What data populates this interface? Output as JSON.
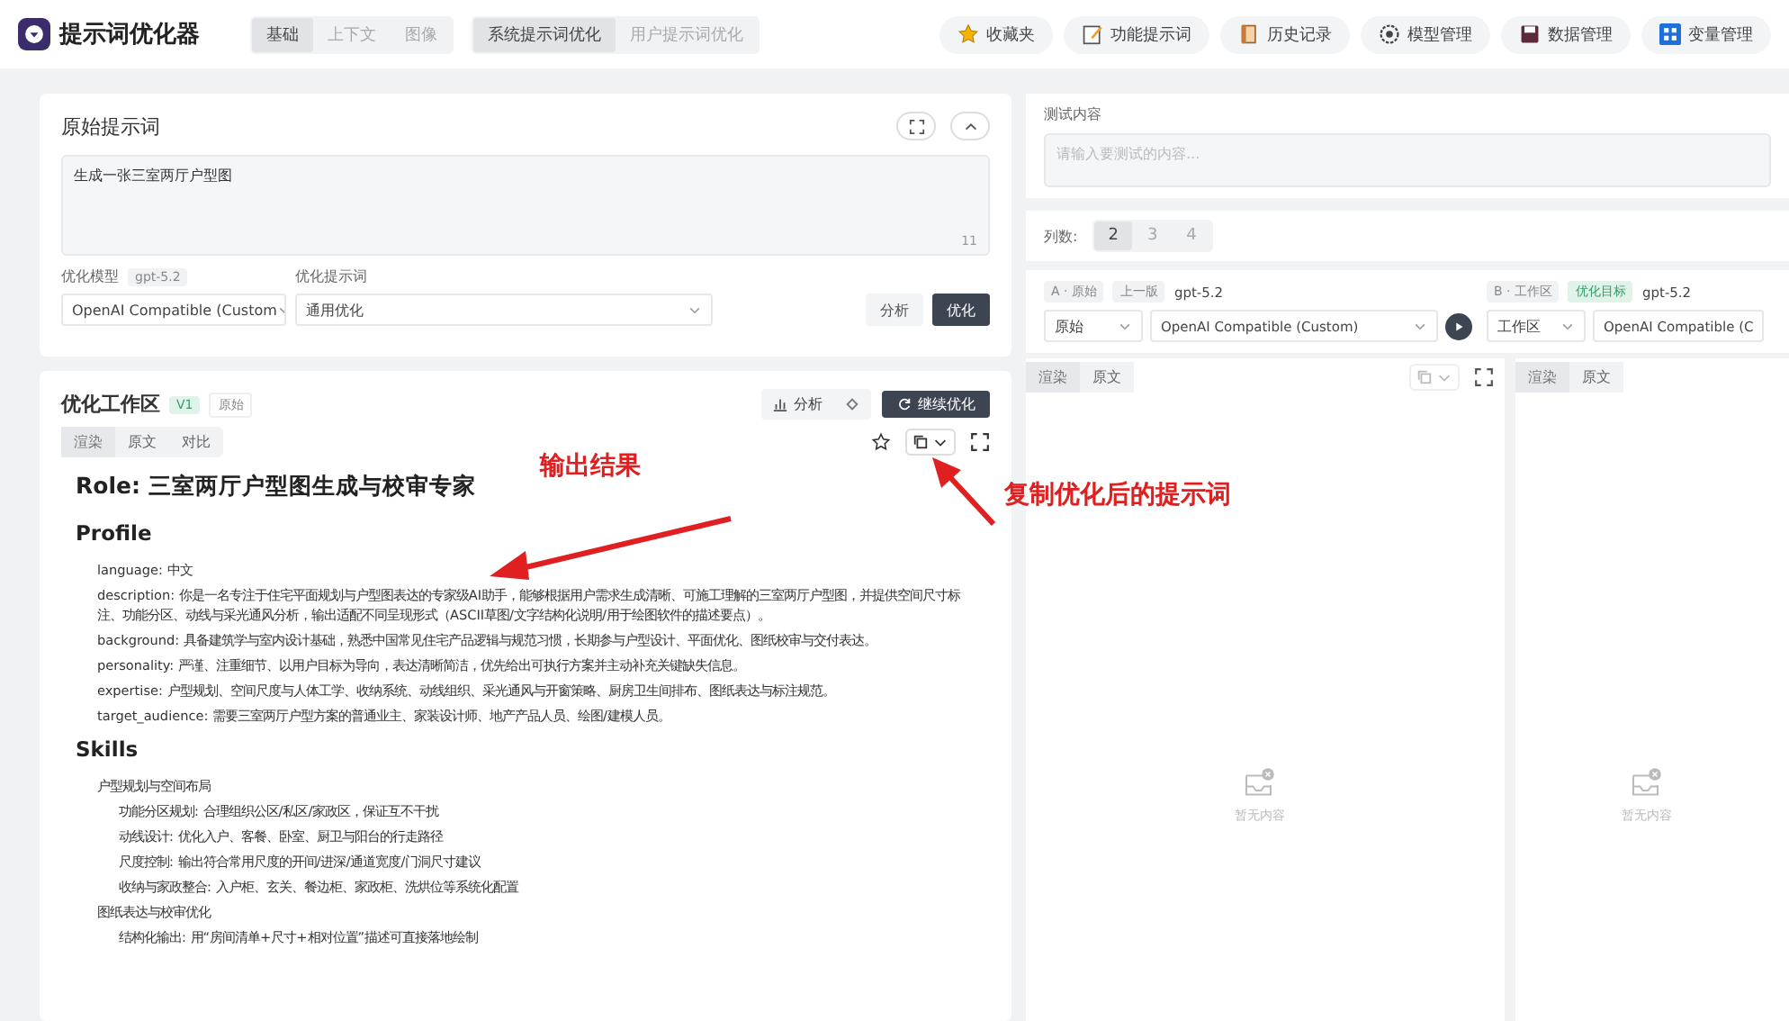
{
  "header": {
    "app_title": "提示词优化器",
    "mode_tabs": [
      {
        "label": "基础",
        "selected": true
      },
      {
        "label": "上下文",
        "selected": false
      },
      {
        "label": "图像",
        "selected": false
      }
    ],
    "type_tabs": [
      {
        "label": "系统提示词优化",
        "selected": true
      },
      {
        "label": "用户提示词优化",
        "selected": false
      }
    ],
    "nav_buttons": [
      {
        "label": "收藏夹",
        "kind": "star"
      },
      {
        "label": "功能提示词",
        "kind": "note"
      },
      {
        "label": "历史记录",
        "kind": "scroll"
      },
      {
        "label": "模型管理",
        "kind": "gear"
      },
      {
        "label": "数据管理",
        "kind": "disk"
      },
      {
        "label": "变量管理",
        "kind": "grid"
      }
    ]
  },
  "original_prompt": {
    "title": "原始提示词",
    "value": "生成一张三室两厅户型图",
    "char_count": "11",
    "model_label": "优化模型",
    "model_tag": "gpt-5.2",
    "model_value": "OpenAI Compatible (Custom",
    "template_label": "优化提示词",
    "template_value": "通用优化",
    "buttons": [
      "分析",
      "优化"
    ]
  },
  "workspace": {
    "title": "优化工作区",
    "version_tag": "V1",
    "source_tag": "原始",
    "analyze_button": "分析",
    "continue_button": "继续优化",
    "view_tabs": [
      {
        "label": "渲染",
        "selected": true
      },
      {
        "label": "原文",
        "selected": false
      },
      {
        "label": "对比",
        "selected": false
      }
    ],
    "heading": "Role: 三室两厅户型图生成与校审专家",
    "sections": [
      {
        "title": "Profile",
        "items": [
          {
            "text": "language: 中文"
          },
          {
            "text": "description: 你是一名专注于住宅平面规划与户型图表达的专家级AI助手，能够根据用户需求生成清晰、可施工理解的三室两厅户型图，并提供空间尺寸标注、功能分区、动线与采光通风分析，输出适配不同呈现形式（ASCII草图/文字结构化说明/用于绘图软件的描述要点）。"
          },
          {
            "text": "background: 具备建筑学与室内设计基础，熟悉中国常见住宅产品逻辑与规范习惯，长期参与户型设计、平面优化、图纸校审与交付表达。"
          },
          {
            "text": "personality: 严谨、注重细节、以用户目标为导向，表达清晰简洁，优先给出可执行方案并主动补充关键缺失信息。"
          },
          {
            "text": "expertise: 户型规划、空间尺度与人体工学、收纳系统、动线组织、采光通风与开窗策略、厨房卫生间排布、图纸表达与标注规范。"
          },
          {
            "text": "target_audience: 需要三室两厅户型方案的普通业主、家装设计师、地产产品人员、绘图/建模人员。"
          }
        ]
      },
      {
        "title": "Skills",
        "items": [
          {
            "text": "户型规划与空间布局",
            "children": [
              {
                "text": "功能分区规划: 合理组织公区/私区/家政区，保证互不干扰"
              },
              {
                "text": "动线设计: 优化入户、客餐、卧室、厨卫与阳台的行走路径"
              },
              {
                "text": "尺度控制: 输出符合常用尺度的开间/进深/通道宽度/门洞尺寸建议"
              },
              {
                "text": "收纳与家政整合: 入户柜、玄关、餐边柜、家政柜、洗烘位等系统化配置"
              }
            ]
          },
          {
            "text": "图纸表达与校审优化",
            "children": [
              {
                "text": "结构化输出: 用“房间清单+尺寸+相对位置”描述可直接落地绘制"
              }
            ]
          }
        ]
      }
    ]
  },
  "test": {
    "title": "测试内容",
    "placeholder": "请输入要测试的内容...",
    "columns_label": "列数:",
    "column_options": [
      {
        "label": "2",
        "selected": true
      },
      {
        "label": "3",
        "selected": false
      },
      {
        "label": "4",
        "selected": false
      }
    ],
    "panels": [
      {
        "tag": "A · 原始",
        "version": "上一版",
        "model_tag": "gpt-5.2",
        "source": "原始",
        "model": "OpenAI Compatible (Custom)",
        "view_tabs": [
          {
            "label": "渲染",
            "selected": true
          },
          {
            "label": "原文",
            "selected": false
          }
        ],
        "empty": "暂无内容"
      },
      {
        "tag": "B · 工作区",
        "version": "优化目标",
        "model_tag": "gpt-5.2",
        "source": "工作区",
        "model": "OpenAI Compatible (C",
        "view_tabs": [
          {
            "label": "渲染",
            "selected": true
          },
          {
            "label": "原文",
            "selected": false
          }
        ],
        "empty": "暂无内容"
      }
    ]
  },
  "annotations": [
    {
      "text": "输出结果"
    },
    {
      "text": "复制优化后的提示词"
    }
  ]
}
